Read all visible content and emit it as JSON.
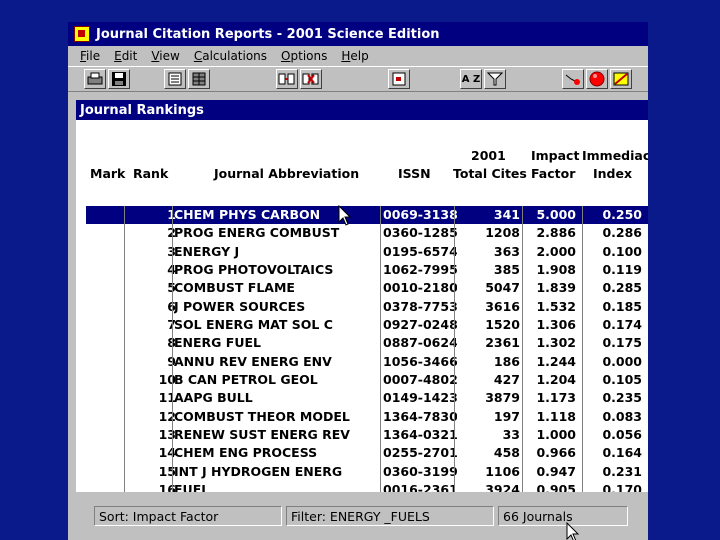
{
  "window": {
    "title": "Journal Citation Reports - 2001 Science Edition"
  },
  "menu": [
    "File",
    "Edit",
    "View",
    "Calculations",
    "Options",
    "Help"
  ],
  "toolbar": {
    "sort_label": "A Z"
  },
  "panel": {
    "title": "Journal Rankings"
  },
  "columns": {
    "mark": "Mark",
    "rank": "Rank",
    "abbrev": "Journal Abbreviation",
    "issn": "ISSN",
    "cites_line1": "2001",
    "cites_line2": "Total Cites",
    "if_line1": "Impact",
    "if_line2": "Factor",
    "imm_line1": "Immediacy",
    "imm_line2": "Index"
  },
  "rows": [
    {
      "rank": "1",
      "abbrev": "CHEM PHYS CARBON",
      "issn": "0069-3138",
      "cites": "341",
      "if": "5.000",
      "imm": "0.250"
    },
    {
      "rank": "2",
      "abbrev": "PROG ENERG COMBUST",
      "issn": "0360-1285",
      "cites": "1208",
      "if": "2.886",
      "imm": "0.286"
    },
    {
      "rank": "3",
      "abbrev": "ENERGY J",
      "issn": "0195-6574",
      "cites": "363",
      "if": "2.000",
      "imm": "0.100"
    },
    {
      "rank": "4",
      "abbrev": "PROG PHOTOVOLTAICS",
      "issn": "1062-7995",
      "cites": "385",
      "if": "1.908",
      "imm": "0.119"
    },
    {
      "rank": "5",
      "abbrev": "COMBUST FLAME",
      "issn": "0010-2180",
      "cites": "5047",
      "if": "1.839",
      "imm": "0.285"
    },
    {
      "rank": "6",
      "abbrev": "J POWER SOURCES",
      "issn": "0378-7753",
      "cites": "3616",
      "if": "1.532",
      "imm": "0.185"
    },
    {
      "rank": "7",
      "abbrev": "SOL ENERG MAT SOL C",
      "issn": "0927-0248",
      "cites": "1520",
      "if": "1.306",
      "imm": "0.174"
    },
    {
      "rank": "8",
      "abbrev": "ENERG FUEL",
      "issn": "0887-0624",
      "cites": "2361",
      "if": "1.302",
      "imm": "0.175"
    },
    {
      "rank": "9",
      "abbrev": "ANNU REV ENERG ENV",
      "issn": "1056-3466",
      "cites": "186",
      "if": "1.244",
      "imm": "0.000"
    },
    {
      "rank": "10",
      "abbrev": "B CAN PETROL GEOL",
      "issn": "0007-4802",
      "cites": "427",
      "if": "1.204",
      "imm": "0.105"
    },
    {
      "rank": "11",
      "abbrev": "AAPG BULL",
      "issn": "0149-1423",
      "cites": "3879",
      "if": "1.173",
      "imm": "0.235"
    },
    {
      "rank": "12",
      "abbrev": "COMBUST THEOR MODEL",
      "issn": "1364-7830",
      "cites": "197",
      "if": "1.118",
      "imm": "0.083"
    },
    {
      "rank": "13",
      "abbrev": "RENEW SUST ENERG REV",
      "issn": "1364-0321",
      "cites": "33",
      "if": "1.000",
      "imm": "0.056"
    },
    {
      "rank": "14",
      "abbrev": "CHEM ENG PROCESS",
      "issn": "0255-2701",
      "cites": "458",
      "if": "0.966",
      "imm": "0.164"
    },
    {
      "rank": "15",
      "abbrev": "INT J HYDROGEN ENERG",
      "issn": "0360-3199",
      "cites": "1106",
      "if": "0.947",
      "imm": "0.231"
    },
    {
      "rank": "16",
      "abbrev": "FUEL",
      "issn": "0016-2361",
      "cites": "3924",
      "if": "0.905",
      "imm": "0.170"
    }
  ],
  "status": {
    "sort": "Sort: Impact Factor",
    "filter": "Filter: ENERGY _FUELS",
    "count": "66 Journals"
  },
  "colors": {
    "selection": "#000080",
    "background": "#0b1a8a",
    "window": "#c0c0c0"
  }
}
